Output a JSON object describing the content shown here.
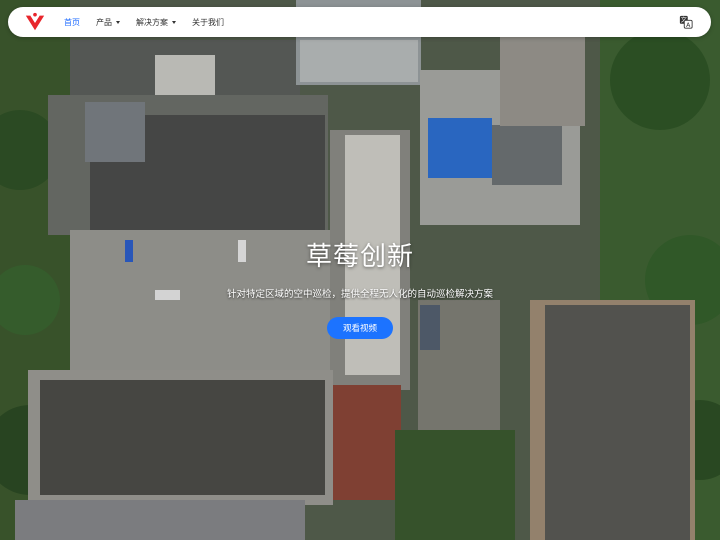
{
  "nav": {
    "items": [
      {
        "label": "首页",
        "active": true,
        "dropdown": false
      },
      {
        "label": "产品",
        "active": false,
        "dropdown": true
      },
      {
        "label": "解决方案",
        "active": false,
        "dropdown": true
      },
      {
        "label": "关于我们",
        "active": false,
        "dropdown": false
      }
    ],
    "language_icon": "translate-icon",
    "logo_icon": "brand-logo",
    "accent_color": "#1e6bff"
  },
  "hero": {
    "title": "草莓创新",
    "subtitle": "针对特定区域的空中巡检，提供全程无人化的自动巡检解决方案",
    "button_label": "观看视频",
    "button_color": "#1c73ff"
  },
  "background": {
    "description_icon": "aerial-photo"
  }
}
